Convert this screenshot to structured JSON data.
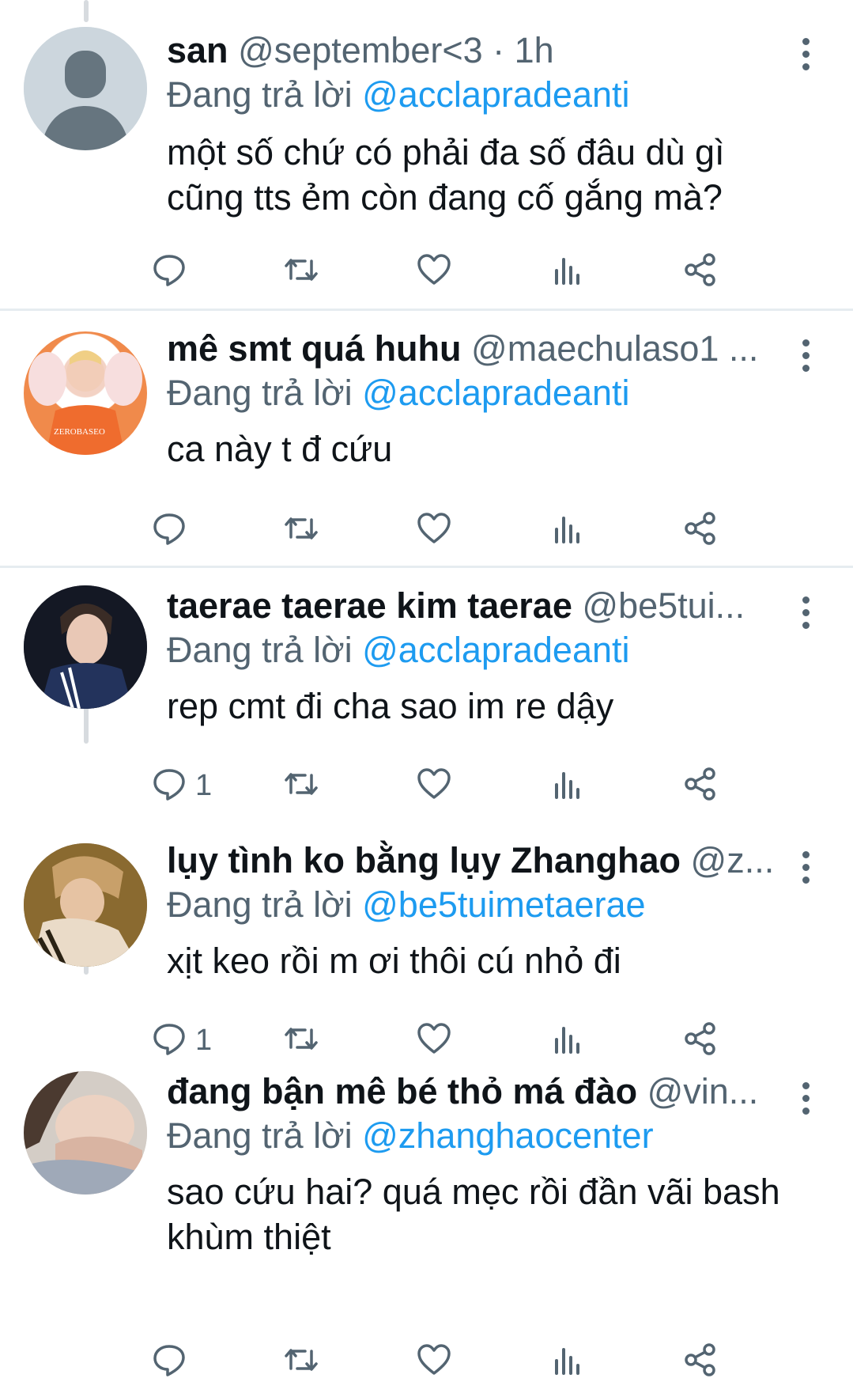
{
  "colors": {
    "mention": "#1d9bf0",
    "meta": "#536471",
    "divider": "#e6ecf0",
    "thread_line": "#d7dbdf"
  },
  "replying_prefix": "Đang trả lời",
  "tweets": [
    {
      "name": "san",
      "meta": "@september<3 · 1h",
      "reply_to": "@acclapradeanti",
      "text": "một số chứ có phải đa số đâu dù gì cũng tts ẻm còn đang cố gắng mà?",
      "reply_count": "",
      "avatar": "default-avatar-icon"
    },
    {
      "name": "mê smt quá huhu",
      "meta": "@maechulaso1 ...",
      "reply_to": "@acclapradeanti",
      "text": "ca này t đ cứu",
      "reply_count": "",
      "avatar": "user-photo"
    },
    {
      "name": "taerae taerae kim taerae",
      "meta": "@be5tui...",
      "reply_to": "@acclapradeanti",
      "text": "rep cmt đi cha sao im re dậy",
      "reply_count": "1",
      "avatar": "user-photo"
    },
    {
      "name": "lụy tình ko bằng lụy Zhanghao",
      "meta": "@z...",
      "reply_to": "@be5tuimetaerae",
      "text": "xịt keo rồi m ơi thôi cú nhỏ đi",
      "reply_count": "1",
      "avatar": "user-photo"
    },
    {
      "name": "đang bận mê bé thỏ má đào",
      "meta": "@vin...",
      "reply_to": "@zhanghaocenter",
      "text": "sao cứu hai? quá mẹc rồi đần vãi bash khùm thiệt",
      "reply_count": "",
      "avatar": "user-photo"
    }
  ]
}
